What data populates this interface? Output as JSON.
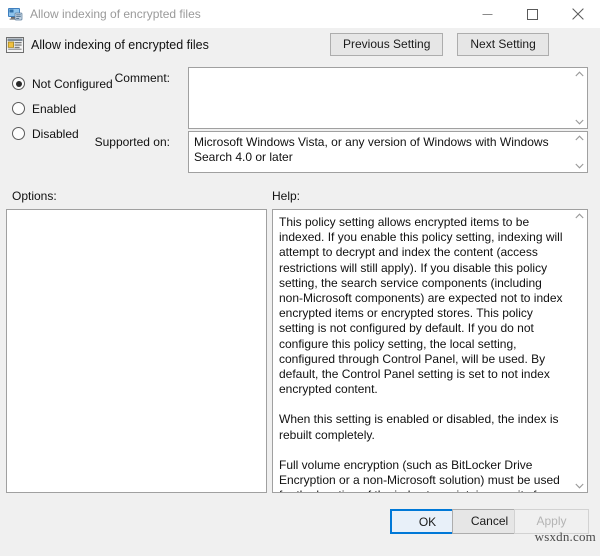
{
  "window": {
    "title": "Allow indexing of encrypted files",
    "icon": "computer-policy-icon",
    "controls": {
      "minimize": "minimize-icon",
      "maximize": "maximize-icon",
      "close": "close-icon"
    }
  },
  "header": {
    "icon": "group-policy-setting-icon",
    "title": "Allow indexing of encrypted files",
    "previous_setting": "Previous Setting",
    "next_setting": "Next Setting"
  },
  "state_options": [
    {
      "label": "Not Configured",
      "selected": true
    },
    {
      "label": "Enabled",
      "selected": false
    },
    {
      "label": "Disabled",
      "selected": false
    }
  ],
  "fields": {
    "comment_label": "Comment:",
    "comment_value": "",
    "supported_label": "Supported on:",
    "supported_value": "Microsoft Windows Vista, or any version of Windows with Windows Search 4.0 or later"
  },
  "panels": {
    "options_label": "Options:",
    "options_content": "",
    "help_label": "Help:",
    "help_paragraphs": [
      "This policy setting allows encrypted items to be indexed. If you enable this policy setting, indexing  will attempt to decrypt and index the content (access restrictions will still apply). If you disable this policy setting, the search service components (including non-Microsoft components) are expected not to index encrypted items or encrypted stores. This policy setting is not configured by default. If you do not configure this policy setting, the local setting, configured through Control Panel, will be used. By default, the Control Panel setting is set to not index encrypted content.",
      "When this setting is enabled or disabled, the index is rebuilt completely.",
      "Full volume encryption (such as BitLocker Drive Encryption or a non-Microsoft solution) must be used for the location of the index to maintain security for encrypted files."
    ]
  },
  "footer": {
    "ok": "OK",
    "cancel": "Cancel",
    "apply": "Apply",
    "apply_disabled": true
  },
  "watermark": "wsxdn.com",
  "colors": {
    "window_background": "#f0f0f0",
    "titlebar_background": "#ffffff",
    "field_background": "#ffffff",
    "border": "#a0a0a0",
    "focus_accent": "#0078d7",
    "disabled_text": "#b4b4b4",
    "inactive_title_text": "#9a9a9a"
  }
}
